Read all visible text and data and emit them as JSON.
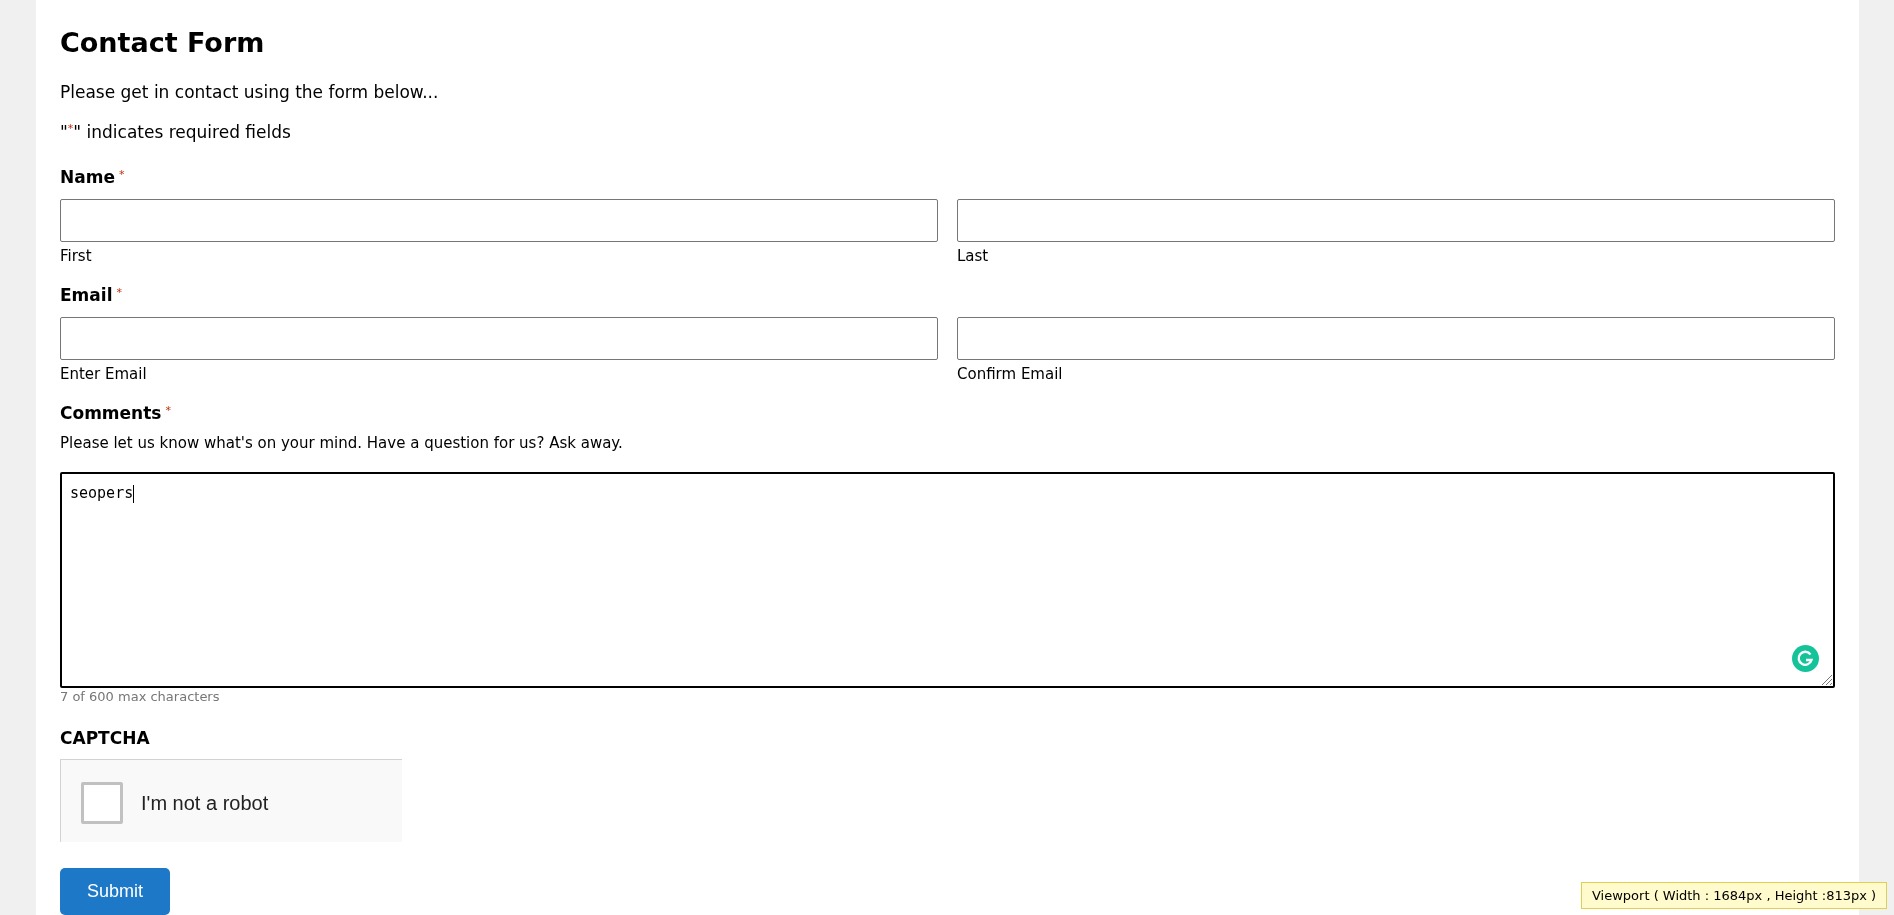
{
  "title": "Contact Form",
  "intro": "Please get in contact using the form below...",
  "legend": {
    "before": "\"",
    "mark": "*",
    "after": "\" indicates required fields"
  },
  "name": {
    "label": "Name",
    "required_mark": "*",
    "fields": [
      {
        "sublabel": "First"
      },
      {
        "sublabel": "Last"
      }
    ]
  },
  "email": {
    "label": "Email",
    "required_mark": "*",
    "fields": [
      {
        "sublabel": "Enter Email"
      },
      {
        "sublabel": "Confirm Email"
      }
    ]
  },
  "comments": {
    "label": "Comments",
    "required_mark": "*",
    "description": "Please let us know what's on your mind. Have a question for us? Ask away.",
    "value": "seopers",
    "counter": "7 of 600 max characters"
  },
  "captcha": {
    "label": "CAPTCHA",
    "checkbox_label": "I'm not a robot",
    "checked": false
  },
  "submit": "Submit",
  "viewport_tooltip": "Viewport ( Width : 1684px , Height :813px )"
}
